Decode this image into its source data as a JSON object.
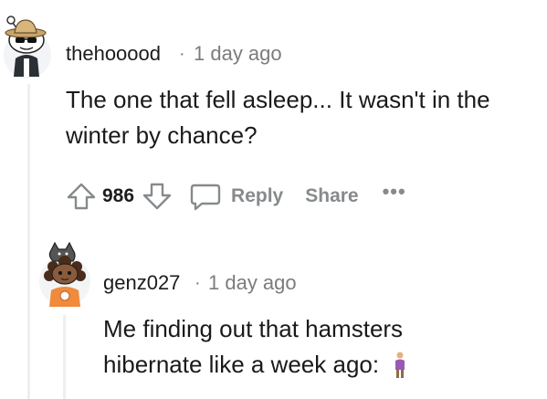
{
  "comments": [
    {
      "username": "thehooood",
      "separator": "·",
      "time": "1 day ago",
      "avatar_icon": "snoo-cowboy-sunglasses-avatar",
      "lines": [
        "The one that fell asleep... It wasn't in the",
        "winter by chance?"
      ],
      "score": "986",
      "reply_label": "Reply",
      "share_label": "Share",
      "more_label": "•••"
    },
    {
      "username": "genz027",
      "separator": "·",
      "time": "1 day ago",
      "avatar_icon": "snoo-curly-hair-cat-avatar",
      "lines": [
        "Me finding out that hamsters",
        "hibernate like a week ago:"
      ],
      "emoji": "person-standing-emoji"
    }
  ],
  "colors": {
    "text": "#1a1a1b",
    "meta": "#7c7c7c",
    "action": "#878a8c",
    "thread_line": "#edeff1"
  }
}
